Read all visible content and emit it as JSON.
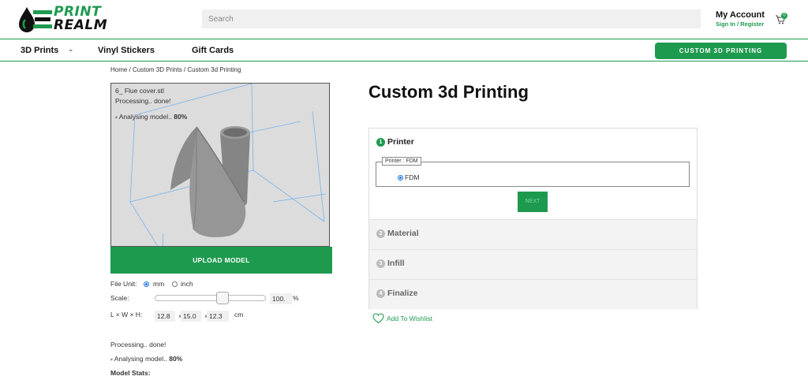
{
  "header": {
    "logo": {
      "line1": "PRINT",
      "line2": "REALM"
    },
    "search": {
      "placeholder": "Search",
      "value": ""
    },
    "account": {
      "title": "My Account",
      "links": "Sign In / Register"
    },
    "cart": {
      "count": "0"
    }
  },
  "nav": {
    "items": [
      {
        "label": "3D Prints",
        "has_dropdown": true
      },
      {
        "label": "Vinyl Stickers"
      },
      {
        "label": "Gift Cards"
      }
    ],
    "cta_label": "CUSTOM 3D PRINTING"
  },
  "breadcrumb": "Home / Custom 3D Prints / Custom 3d Printing",
  "viewer": {
    "file_name": "6_ Flue cover.stl",
    "processing": "Processing.. done!",
    "analysing_label": "Analysing model..",
    "analysing_pct": "80%"
  },
  "upload_label": "UPLOAD MODEL",
  "controls": {
    "file_unit_label": "File Unit:",
    "unit_options": [
      "mm",
      "inch"
    ],
    "unit_selected": "mm",
    "scale_label": "Scale:",
    "scale_value": "100.",
    "scale_unit": "%",
    "scale_level_pct": 62,
    "dims_label": "L × W × H:",
    "length": "12.8",
    "width": "15.0",
    "height": "12.3",
    "dims_sep": "×",
    "dims_unit": "cm"
  },
  "stats": {
    "processing": "Processing.. done!",
    "analysing_label": "Analysing model..",
    "analysing_pct": "80%",
    "model_stats_label": "Model Stats:"
  },
  "title": "Custom 3d Printing",
  "steps": [
    {
      "num": "1",
      "label": "Printer",
      "active": true
    },
    {
      "num": "2",
      "label": "Material"
    },
    {
      "num": "3",
      "label": "Infill"
    },
    {
      "num": "4",
      "label": "Finalize"
    }
  ],
  "printer": {
    "legend": "Printer : FDM",
    "option": "FDM",
    "next_label": "NEXT"
  },
  "wishlist_label": "Add To Wishlist",
  "colors": {
    "brand": "#1e9a4f"
  }
}
